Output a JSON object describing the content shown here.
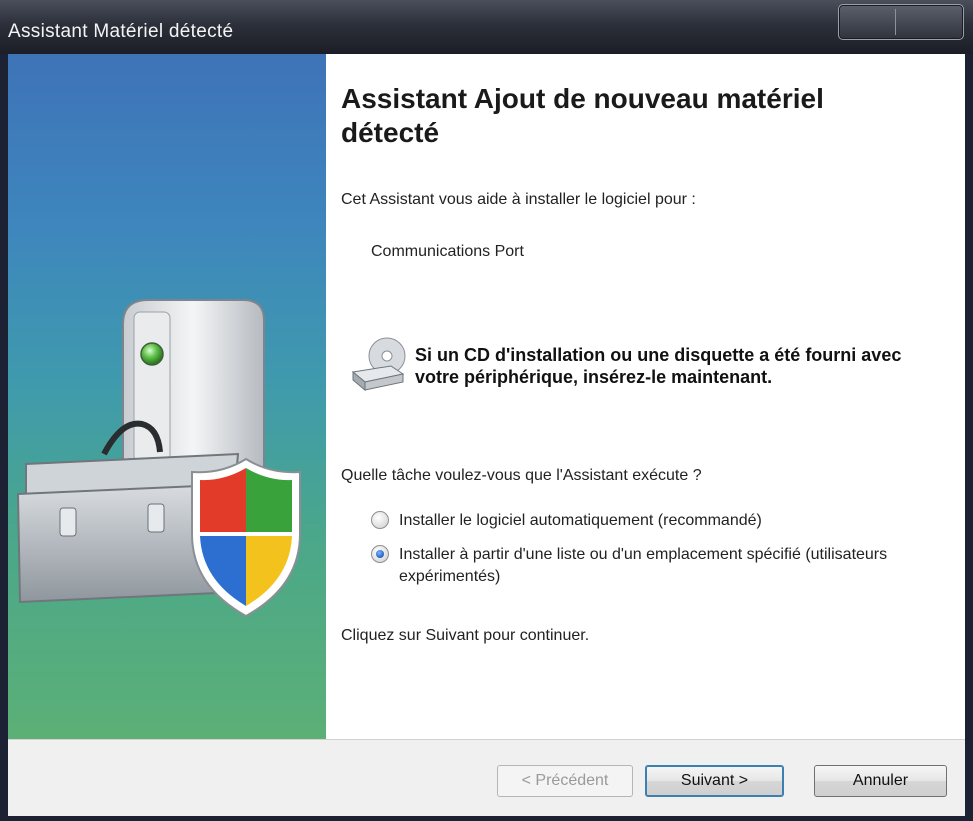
{
  "window": {
    "title": "Assistant Matériel détecté"
  },
  "wizard": {
    "heading": "Assistant Ajout de nouveau matériel détecté",
    "intro": "Cet Assistant vous aide à installer le logiciel pour :",
    "device_name": "Communications Port",
    "cd_note": "Si un CD d'installation ou une disquette a été fourni avec votre périphérique, insérez-le maintenant.",
    "question": "Quelle tâche voulez-vous que l'Assistant exécute ?",
    "options": [
      {
        "label": "Installer le logiciel automatiquement (recommandé)",
        "selected": false
      },
      {
        "label": "Installer à partir d'une liste ou d'un emplacement spécifié (utilisateurs expérimentés)",
        "selected": true
      }
    ],
    "continue_text": "Cliquez sur Suivant pour continuer."
  },
  "footer": {
    "back_label": "< Précédent",
    "next_label": "Suivant >",
    "cancel_label": "Annuler"
  },
  "icons": [
    "hardware-toolbox-icon",
    "security-shield-icon",
    "cd-drive-icon"
  ]
}
